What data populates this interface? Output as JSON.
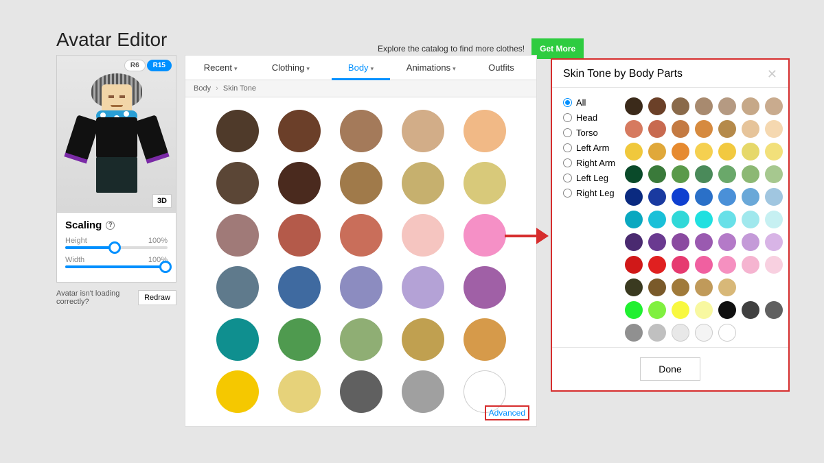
{
  "page_title": "Avatar Editor",
  "cta": {
    "text": "Explore the catalog to find more clothes!",
    "button": "Get More"
  },
  "rig": {
    "r6": "R6",
    "r15": "R15",
    "active": "r15",
    "threeD": "3D"
  },
  "scaling": {
    "title": "Scaling",
    "height_label": "Height",
    "height_value": "100%",
    "height_pct": 48,
    "width_label": "Width",
    "width_value": "100%",
    "width_pct": 98
  },
  "redraw": {
    "text": "Avatar isn't loading correctly?",
    "button": "Redraw"
  },
  "tabs": [
    {
      "label": "Recent",
      "dropdown": true
    },
    {
      "label": "Clothing",
      "dropdown": true
    },
    {
      "label": "Body",
      "dropdown": true,
      "active": true
    },
    {
      "label": "Animations",
      "dropdown": true
    },
    {
      "label": "Outfits",
      "dropdown": false
    }
  ],
  "breadcrumb": [
    "Body",
    "Skin Tone"
  ],
  "advanced_link": "Advanced",
  "skin_colors": [
    "#4f3a2a",
    "#6b3f29",
    "#a47a5a",
    "#d2ad88",
    "#f1b986",
    "#5b4636",
    "#4a2a1e",
    "#a07a4a",
    "#c6b06e",
    "#d8c97a",
    "#a07a78",
    "#b45a4a",
    "#c96e5a",
    "#f5c5c0",
    "#f590c6",
    "#5f7a8c",
    "#3f6aa0",
    "#8c8cc0",
    "#b4a2d6",
    "#a060a6",
    "#0f8f8f",
    "#4f9a4f",
    "#8fae74",
    "#c0a050",
    "#d69a4a",
    "#f5c800",
    "#e6d27a",
    "#606060",
    "#a0a0a0",
    "#ffffff"
  ],
  "modal": {
    "title": "Skin Tone by Body Parts",
    "done": "Done",
    "body_parts": [
      "All",
      "Head",
      "Torso",
      "Left Arm",
      "Right Arm",
      "Left Leg",
      "Right Leg"
    ],
    "selected_part": "All",
    "palette": [
      [
        "#3b2a1a",
        "#6b4028",
        "#8a6a4a",
        "#a88a6f",
        "#b59a82",
        "#c6a888",
        "#c9ab8e"
      ],
      [
        "#d67a5f",
        "#c86a50",
        "#c47a42",
        "#d68a3f",
        "#b58a4a",
        "#e6c49a",
        "#f5d8b0"
      ],
      [
        "#f0c83c",
        "#e0a83a",
        "#e68a30",
        "#f5d050",
        "#f2c940",
        "#e6d86a",
        "#f2e07a"
      ],
      [
        "#0a4a2a",
        "#3a7a3a",
        "#5a9a4a",
        "#4a8a5a",
        "#6aa86a",
        "#8cb874",
        "#a6c88f"
      ],
      [
        "#0a2a80",
        "#1a3aa0",
        "#1040d0",
        "#2a70c8",
        "#4a90d8",
        "#6aa8d8",
        "#a0c6e0"
      ],
      [
        "#0aa8c0",
        "#1ac0d8",
        "#30d8d8",
        "#20e0e0",
        "#68e0e8",
        "#a0e8ed",
        "#c6f0f2"
      ],
      [
        "#4a2a70",
        "#6a3a90",
        "#8a4aa0",
        "#9a5ab0",
        "#b47ac8",
        "#c49ad8",
        "#d8b4e6"
      ],
      [
        "#d01818",
        "#e02020",
        "#e63a70",
        "#f060a0",
        "#f590c0",
        "#f5b4d0",
        "#f8d0e0"
      ],
      [
        "#3a3a20",
        "#7a5a2a",
        "#a07a3a",
        "#c09a5a",
        "#d8b878",
        null,
        null
      ],
      [
        "#20f030",
        "#80f040",
        "#f8f840",
        "#f8f8a0",
        "#101010",
        "#404040",
        "#606060"
      ],
      [
        "#909090",
        "#c0c0c0",
        "#e8e8e8",
        "#f4f4f4",
        "#ffffff",
        null,
        null
      ]
    ]
  }
}
